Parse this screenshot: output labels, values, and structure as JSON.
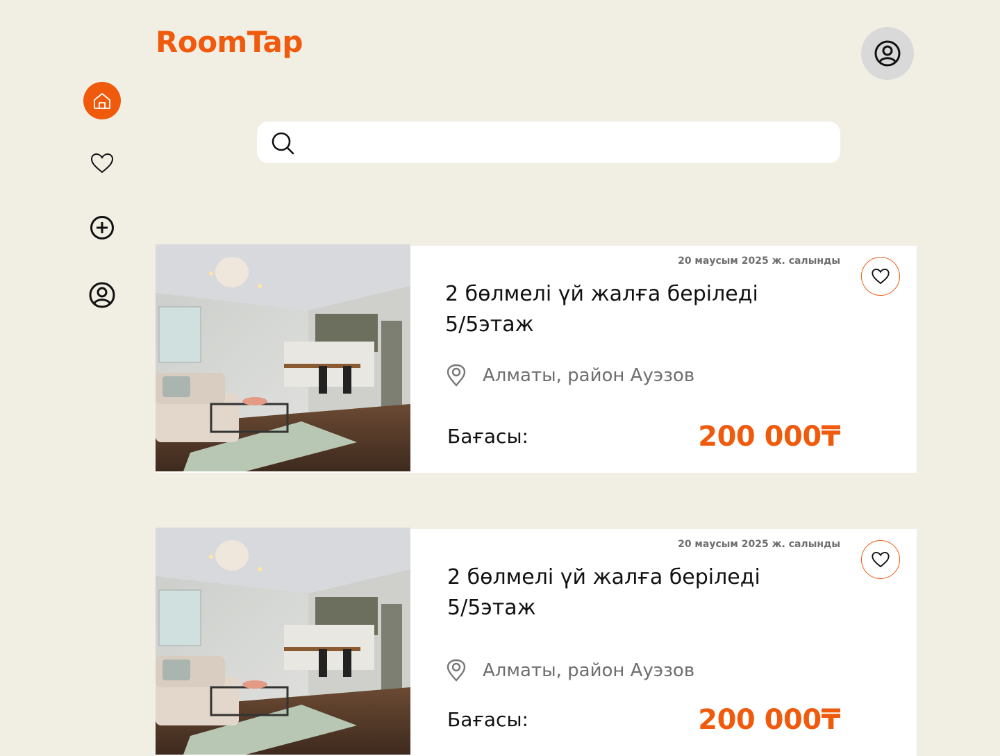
{
  "app": {
    "logo": "RoomTap"
  },
  "header": {
    "profile_icon": "user-circle-icon"
  },
  "sidebar": {
    "items": [
      {
        "name": "home",
        "icon": "home-icon",
        "active": true
      },
      {
        "name": "favorites",
        "icon": "heart-icon",
        "active": false
      },
      {
        "name": "add",
        "icon": "plus-circle-icon",
        "active": false
      },
      {
        "name": "profile",
        "icon": "user-circle-icon",
        "active": false
      }
    ]
  },
  "search": {
    "value": "",
    "placeholder": ""
  },
  "colors": {
    "accent": "#ef5a0c",
    "background": "#f1eee3",
    "muted": "#6e6e6e"
  },
  "listings": [
    {
      "date": "20 маусым 2025 ж. салынды",
      "title": "2 бөлмелі үй жалға беріледі 5/5этаж",
      "location": "Алматы, район Ауэзов",
      "price_label": "Бағасы:",
      "price": "200 000₸"
    },
    {
      "date": "20 маусым 2025 ж. салынды",
      "title": "2 бөлмелі үй жалға беріледі 5/5этаж",
      "location": "Алматы, район Ауэзов",
      "price_label": "Бағасы:",
      "price": "200 000₸"
    }
  ]
}
